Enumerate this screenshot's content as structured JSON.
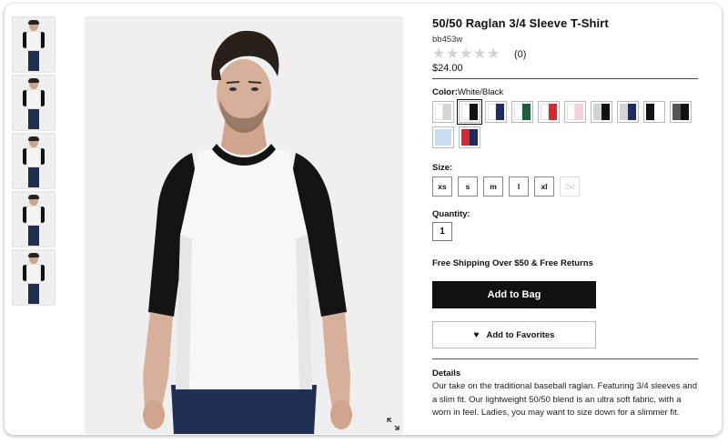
{
  "product": {
    "title": "50/50 Raglan 3/4 Sleeve T-Shirt",
    "sku": "bb453w",
    "rating": 0,
    "rating_count": "(0)",
    "price": "$24.00"
  },
  "color": {
    "label": "Color:",
    "selected": "White/Black",
    "swatches": [
      {
        "name": "White/Heather Grey",
        "a": "#ffffff",
        "b": "#d6d6d6"
      },
      {
        "name": "White/Black",
        "a": "#ffffff",
        "b": "#111111"
      },
      {
        "name": "White/Navy",
        "a": "#ffffff",
        "b": "#1c2c5e"
      },
      {
        "name": "White/Forest",
        "a": "#ffffff",
        "b": "#1f5c3c"
      },
      {
        "name": "White/Red",
        "a": "#ffffff",
        "b": "#d9252f"
      },
      {
        "name": "White/Pink",
        "a": "#ffffff",
        "b": "#f6cfd9"
      },
      {
        "name": "Heather Grey/Black",
        "a": "#d3d3d3",
        "b": "#111111"
      },
      {
        "name": "Heather Grey/Navy",
        "a": "#d3d3d3",
        "b": "#1c2c5e"
      },
      {
        "name": "Black/White",
        "a": "#111111",
        "b": "#ffffff"
      },
      {
        "name": "Charcoal/Black",
        "a": "#555555",
        "b": "#111111"
      },
      {
        "name": "Light Blue",
        "a": "#c7def2",
        "b": "#c7def2"
      },
      {
        "name": "Red/Navy",
        "a": "#d9252f",
        "b": "#1c2c5e"
      }
    ]
  },
  "size": {
    "label": "Size:",
    "options": [
      {
        "label": "xs",
        "available": true
      },
      {
        "label": "s",
        "available": true
      },
      {
        "label": "m",
        "available": true
      },
      {
        "label": "l",
        "available": true
      },
      {
        "label": "xl",
        "available": true
      },
      {
        "label": "2xl",
        "available": false
      }
    ]
  },
  "quantity": {
    "label": "Quantity:",
    "value": "1"
  },
  "shipping": "Free Shipping Over $50 & Free Returns",
  "actions": {
    "add_to_bag": "Add to Bag",
    "add_to_favorites": "Add to Favorites"
  },
  "details": {
    "title": "Details",
    "text": "Our take on the traditional baseball raglan. Featuring 3/4 sleeves and a slim fit. Our lightweight 50/50 blend is an ultra soft fabric, with a worn in feel. Ladies, you may want to size down for a slimmer fit."
  },
  "thumbnails": [
    {
      "name": "front"
    },
    {
      "name": "three-quarter"
    },
    {
      "name": "side"
    },
    {
      "name": "back"
    },
    {
      "name": "full-body"
    }
  ]
}
